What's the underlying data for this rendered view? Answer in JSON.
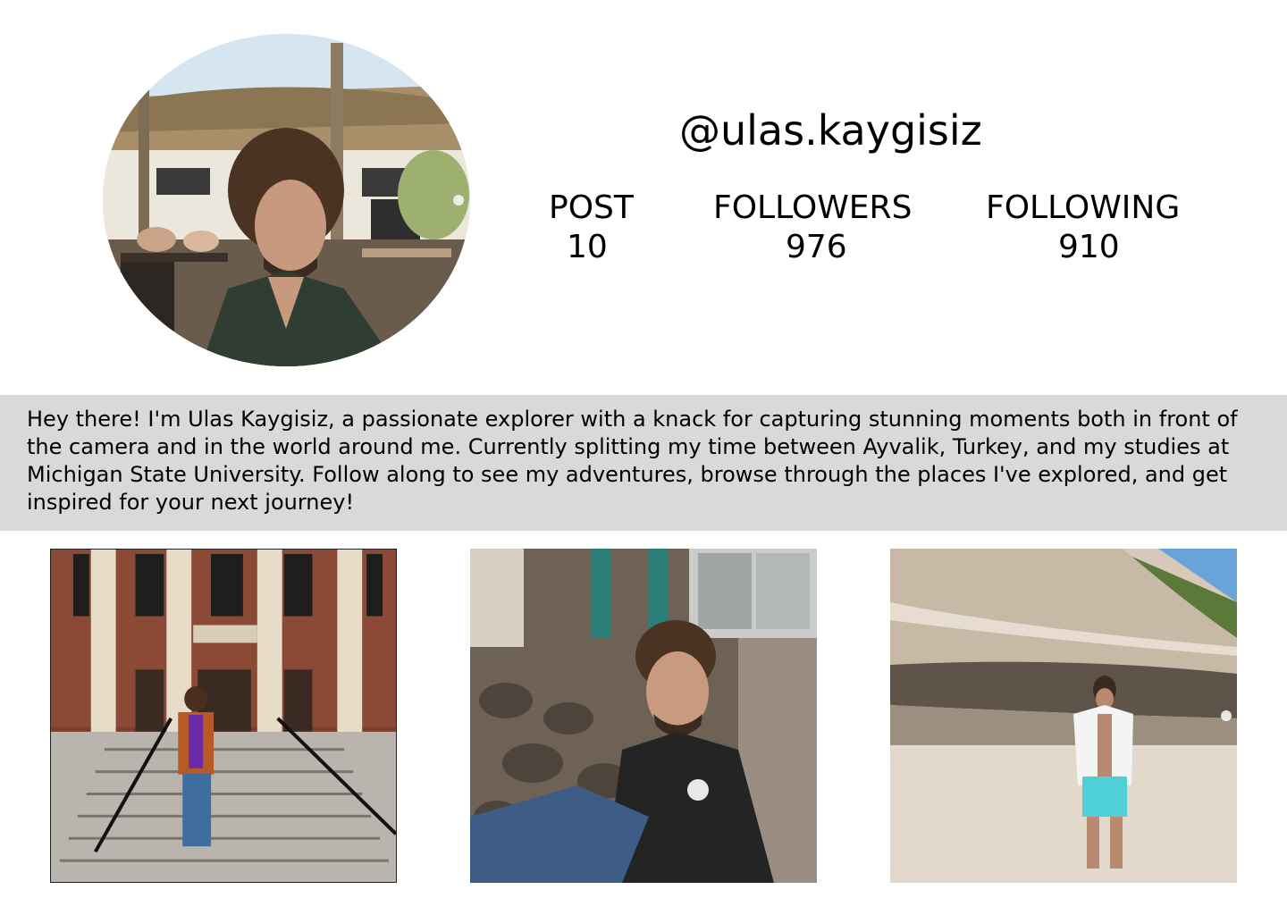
{
  "profile": {
    "username": "@ulas.kaygisiz",
    "avatar": "profile-photo"
  },
  "stats": {
    "posts_label": "POST",
    "posts_value": "10",
    "followers_label": "FOLLOWERS",
    "followers_value": "976",
    "following_label": "FOLLOWING",
    "following_value": "910"
  },
  "bio": {
    "text": "Hey there! I'm Ulas Kaygisiz, a passionate explorer with a knack for capturing stunning moments both in front of the camera and in the world around me. Currently splitting my time between Ayvalik, Turkey, and my studies at Michigan State University. Follow along to see my adventures, browse through the places I've explored, and get inspired for your next journey!"
  },
  "posts": [
    {
      "image": "library-steps-photo"
    },
    {
      "image": "stone-wall-portrait-photo"
    },
    {
      "image": "beach-rock-photo"
    }
  ],
  "colors": {
    "bio_background": "#d9d9d9",
    "text": "#000000",
    "background": "#ffffff"
  }
}
